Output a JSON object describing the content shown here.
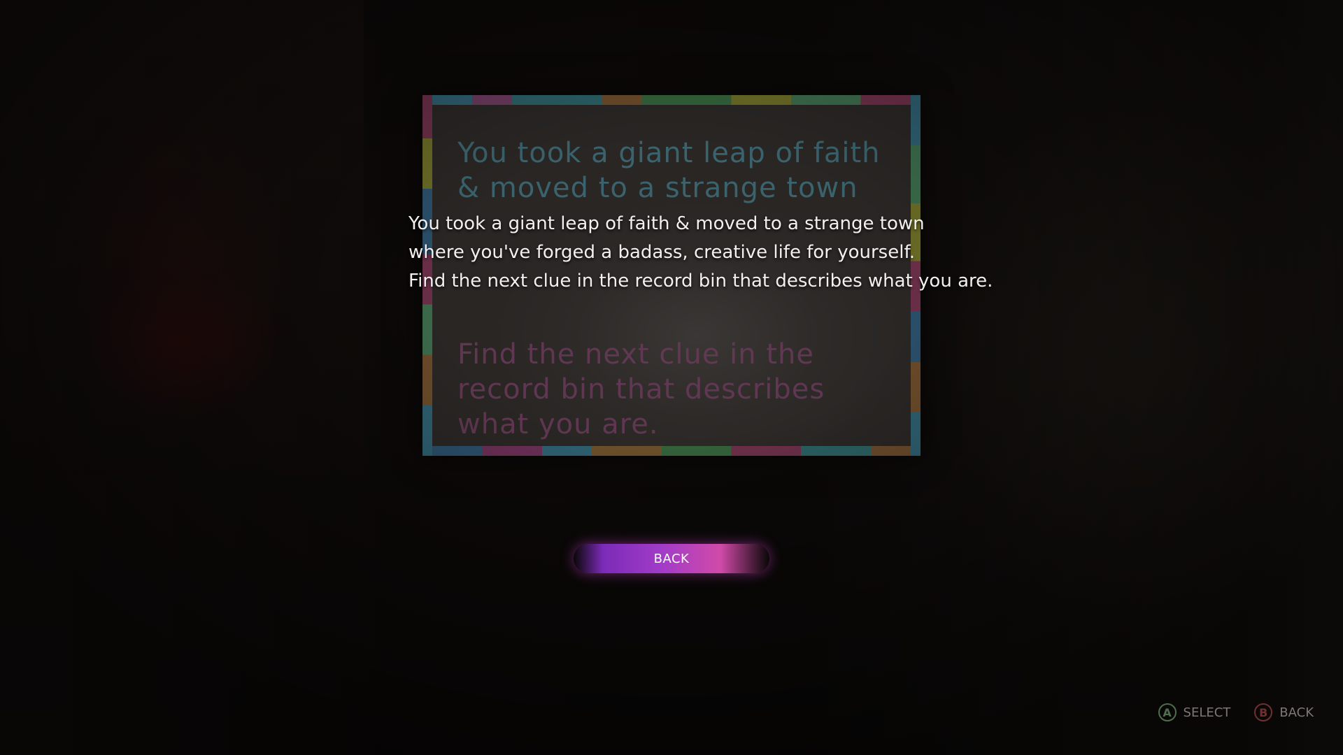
{
  "note": {
    "handwritten_top": "You took a giant leap of faith & moved to a strange town",
    "handwritten_bottom": "Find the next clue in the record bin that describes what you are."
  },
  "caption": {
    "lines": [
      "You took a giant leap of faith & moved to a strange town",
      "where you've forged a badass, creative life for yourself.",
      "Find the next clue in the record bin that describes what you are."
    ]
  },
  "back_button": {
    "label": "BACK"
  },
  "hints": [
    {
      "glyph": "A",
      "label": "SELECT",
      "icon": "a-button-icon",
      "color": "#4e6e4e"
    },
    {
      "glyph": "B",
      "label": "BACK",
      "icon": "b-button-icon",
      "color": "#6e3030"
    }
  ],
  "colors": {
    "button_gradient_start": "#7b2bb8",
    "button_gradient_end": "#d04aa8",
    "caption_text": "#f2f0ee"
  }
}
